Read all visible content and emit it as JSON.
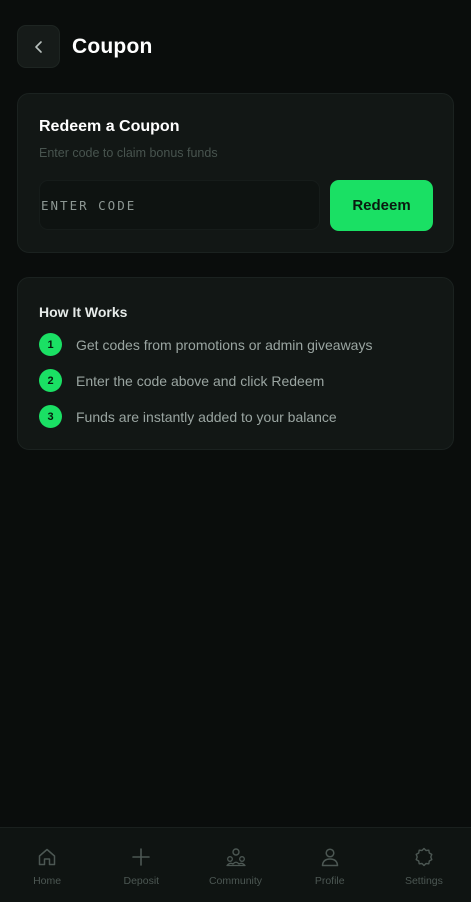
{
  "header": {
    "title": "Coupon"
  },
  "redeem_card": {
    "title": "Redeem a Coupon",
    "subtitle": "Enter code to claim bonus funds",
    "input_placeholder": "ENTER CODE",
    "input_value": "",
    "button_label": "Redeem"
  },
  "how_it_works": {
    "title": "How It Works",
    "steps": [
      {
        "number": "1",
        "text": "Get codes from promotions or admin giveaways"
      },
      {
        "number": "2",
        "text": "Enter the code above and click Redeem"
      },
      {
        "number": "3",
        "text": "Funds are instantly added to your balance"
      }
    ]
  },
  "bottom_nav": {
    "items": [
      {
        "label": "Home",
        "icon": "home-icon"
      },
      {
        "label": "Deposit",
        "icon": "plus-icon"
      },
      {
        "label": "Community",
        "icon": "community-icon"
      },
      {
        "label": "Profile",
        "icon": "profile-icon"
      },
      {
        "label": "Settings",
        "icon": "gear-icon"
      }
    ]
  },
  "colors": {
    "accent": "#1ae064",
    "background": "#0a0d0c",
    "card": "#121715"
  }
}
